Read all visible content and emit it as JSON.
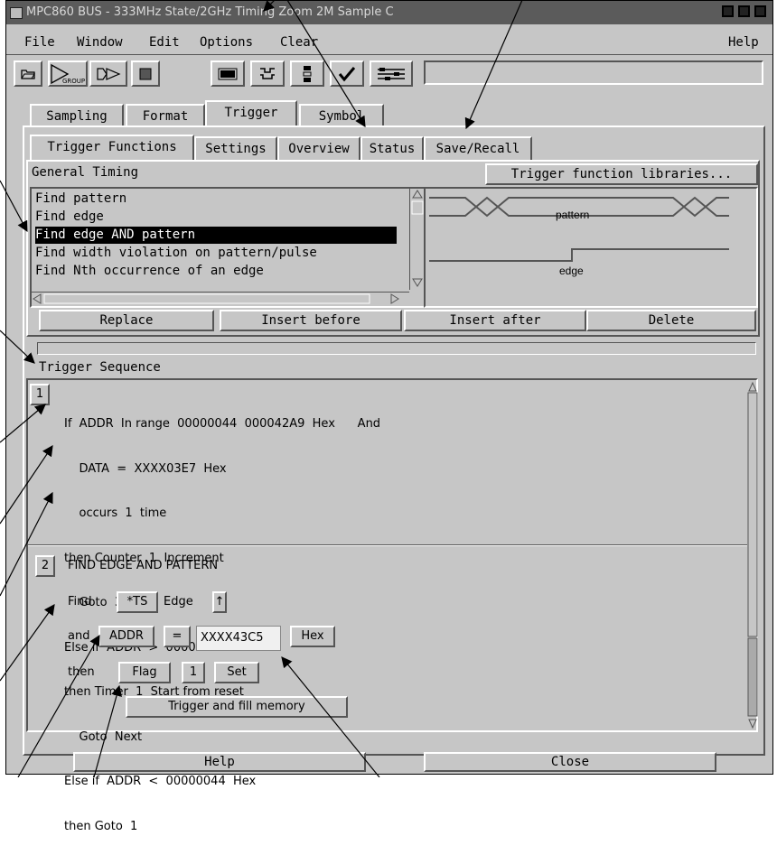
{
  "window": {
    "title": "MPC860 BUS - 333MHz State/2GHz Timing Zoom 2M Sample C"
  },
  "menubar": {
    "file": "File",
    "window": "Window",
    "edit": "Edit",
    "options": "Options",
    "clear": "Clear",
    "help": "Help"
  },
  "toolbar": {
    "group_label": "GROUP"
  },
  "tabs": [
    "Sampling",
    "Format",
    "Trigger",
    "Symbol"
  ],
  "subtabs": [
    "Trigger Functions",
    "Settings",
    "Overview",
    "Status",
    "Save/Recall"
  ],
  "trigger_functions": {
    "category": "General Timing",
    "libraries_button": "Trigger function libraries...",
    "items": [
      "Find pattern",
      "Find edge",
      "Find edge AND pattern",
      "Find width violation on pattern/pulse",
      "Find Nth occurrence of an edge"
    ],
    "selected_index": 2,
    "diagram": {
      "pattern_label": "pattern",
      "edge_label": "edge"
    },
    "buttons": {
      "replace": "Replace",
      "insert_before": "Insert before",
      "insert_after": "Insert after",
      "delete": "Delete"
    }
  },
  "sequence": {
    "title": "Trigger Sequence",
    "step1": {
      "number": "1",
      "lines": [
        "If  ADDR  In range  00000044  000042A9  Hex      And",
        "    DATA  =  XXXX03E7  Hex",
        "    occurs  1  time",
        "then Counter  1  Increment",
        "    Goto  3",
        "Else if  ADDR  >  000042A9  Hex",
        "then Timer  1  Start from reset",
        "    Goto  Next",
        "Else if  ADDR  <  00000044  Hex",
        "then Goto  1"
      ]
    },
    "step2": {
      "number": "2",
      "title": "FIND EDGE AND PATTERN",
      "find_label": "Find",
      "signal": "*TS",
      "edge_label": "Edge",
      "edge_dir": "↑",
      "and_label": "and",
      "label_name": "ADDR",
      "operator": "=",
      "value": "XXXX43C5",
      "base": "Hex",
      "then_label": "then",
      "action": "Flag",
      "flag_num": "1",
      "flag_op": "Set",
      "final_action": "Trigger and fill memory"
    }
  },
  "footer": {
    "help": "Help",
    "close": "Close"
  }
}
